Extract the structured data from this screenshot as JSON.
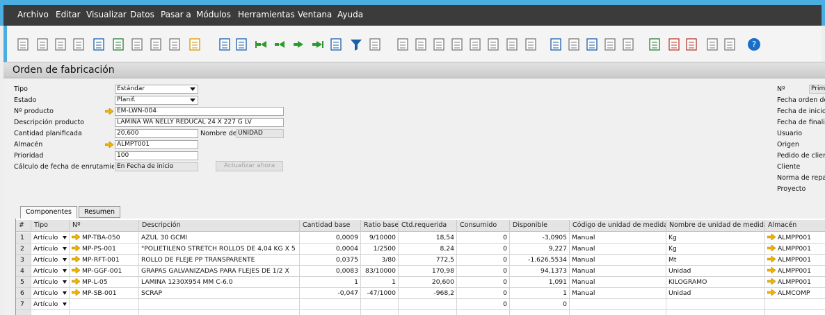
{
  "menu": [
    "Archivo",
    "Editar",
    "Visualizar",
    "Datos",
    "Pasar a",
    "Módulos",
    "Herramientas",
    "Ventana",
    "Ayuda"
  ],
  "toolbar_icons": [
    "preview-icon",
    "print-icon",
    "email-icon",
    "sms-icon",
    "fax-icon",
    "excel-icon",
    "word-icon",
    "pdf-icon",
    "launch-icon",
    "lock-icon",
    "find-icon",
    "form-settings-icon",
    "first-record-icon",
    "previous-record-icon",
    "next-record-icon",
    "last-record-icon",
    "refresh-icon",
    "filter-icon",
    "sort-icon",
    "base-document-icon",
    "target-document-icon",
    "copy-icon",
    "cash-icon",
    "drilldown-icon",
    "gross-profit-icon",
    "payment-icon",
    "settings-icon",
    "edit-icon",
    "add-doc-icon",
    "query-icon",
    "messages-icon",
    "alerts-icon",
    "calendar-icon",
    "close-doc-icon",
    "report-icon",
    "structure-icon",
    "user-icon",
    "help-icon"
  ],
  "window": {
    "title": "Orden de fabricación"
  },
  "form": {
    "tipo_label": "Tipo",
    "tipo_value": "Estándar",
    "estado_label": "Estado",
    "estado_value": "Planif.",
    "producto_label": "Nº producto",
    "producto_value": "EM-LWN-004",
    "descripcion_label": "Descripción producto",
    "descripcion_value": "LAMINA WA NELLY REDUCAL 24 X 227 G LV",
    "cantidad_label": "Cantidad planificada",
    "cantidad_value": "20,600",
    "nombre_label": "Nombre de",
    "nombre_value": "UNIDAD",
    "almacen_label": "Almacén",
    "almacen_value": "ALMPT001",
    "prioridad_label": "Prioridad",
    "prioridad_value": "100",
    "calculo_label": "Cálculo de fecha de enrutamiento",
    "calculo_value": "En Fecha de inicio",
    "update_button": "Actualizar ahora"
  },
  "right_labels": [
    "Nº",
    "Fecha orden de",
    "Fecha de inicio",
    "Fecha de finaliz",
    "Usuario",
    "Origen",
    "Pedido de client",
    "Cliente",
    "Norma de repar",
    "Proyecto"
  ],
  "right_no_value": "Prim",
  "tabs": [
    "Componentes",
    "Resumen"
  ],
  "grid": {
    "headers": [
      "#",
      "Tipo",
      "Nº",
      "Descripción",
      "Cantidad base",
      "Ratio base",
      "Ctd.requerida",
      "Consumido",
      "Disponible",
      "Código de unidad de medida",
      "Nombre de unidad de medida",
      "Almacén"
    ],
    "rows": [
      [
        "1",
        "Artículo",
        "MP-TBA-050",
        "AZUL 30 GCMI",
        "0,0009",
        "9/10000",
        "18,54",
        "0",
        "-3,0905",
        "Manual",
        "Kg",
        "ALMPP001"
      ],
      [
        "2",
        "Artículo",
        "MP-PS-001",
        "\"POLIETILENO STRETCH ROLLOS DE 4,04 KG X 5",
        "0,0004",
        "1/2500",
        "8,24",
        "0",
        "9,227",
        "Manual",
        "Kg",
        "ALMPP001"
      ],
      [
        "3",
        "Artículo",
        "MP-RFT-001",
        "ROLLO DE FLEJE PP TRANSPARENTE",
        "0,0375",
        "3/80",
        "772,5",
        "0",
        "-1.626,5534",
        "Manual",
        "Mt",
        "ALMPP001"
      ],
      [
        "4",
        "Artículo",
        "MP-GGF-001",
        "GRAPAS GALVANIZADAS PARA FLEJES DE 1/2 X",
        "0,0083",
        "83/10000",
        "170,98",
        "0",
        "94,1373",
        "Manual",
        "Unidad",
        "ALMPP001"
      ],
      [
        "5",
        "Artículo",
        "MP-L-05",
        "LAMINA 1230X954 MM C-6.0",
        "1",
        "1",
        "20,600",
        "0",
        "1,091",
        "Manual",
        "KILOGRAMO",
        "ALMPP001"
      ],
      [
        "6",
        "Artículo",
        "MP-SB-001",
        "SCRAP",
        "-0,047",
        "-47/1000",
        "-968,2",
        "0",
        "1",
        "Manual",
        "Unidad",
        "ALMCOMP"
      ],
      [
        "7",
        "Artículo",
        "",
        "",
        "",
        "",
        "",
        "0",
        "0",
        "",
        "",
        ""
      ]
    ]
  }
}
